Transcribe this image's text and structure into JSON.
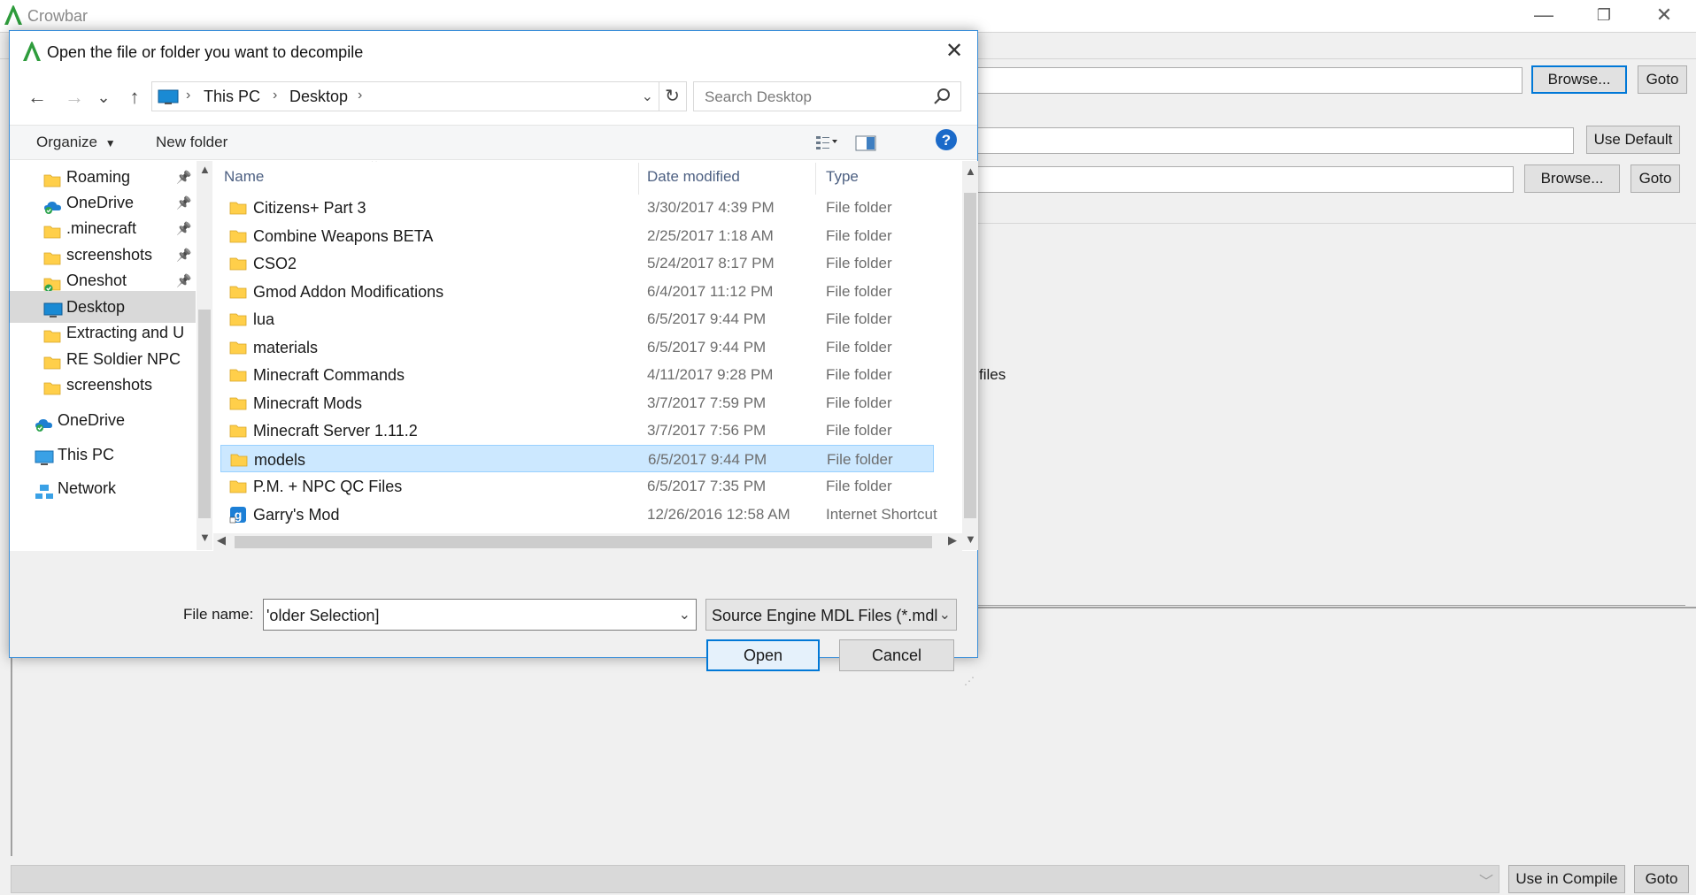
{
  "app": {
    "title": "Crowbar",
    "window_controls": {
      "minimize": "—",
      "restore": "❐",
      "close": "✕"
    },
    "browse_label": "Browse...",
    "goto_label": "Goto",
    "use_default_label": "Use Default",
    "files_label": "files",
    "use_in_compile_label": "Use in Compile",
    "dropdown_glyph": "﹀"
  },
  "dialog": {
    "title": "Open the file or folder you want to decompile",
    "close_glyph": "✕",
    "nav": {
      "back": "←",
      "forward": "→",
      "recent": "⌄",
      "up": "↑"
    },
    "breadcrumbs": [
      "This PC",
      "Desktop"
    ],
    "breadcrumb_sep": "›",
    "address_dropdown": "⌄",
    "refresh": "↻",
    "search_placeholder": "Search Desktop",
    "organize_label": "Organize",
    "new_folder_label": "New folder",
    "sidebar": [
      {
        "label": "Roaming",
        "icon": "folder-icon",
        "pinned": true,
        "selected": false,
        "indent": 1
      },
      {
        "label": "OneDrive",
        "icon": "onedrive-icon",
        "pinned": true,
        "selected": false,
        "indent": 1
      },
      {
        "label": ".minecraft",
        "icon": "folder-icon",
        "pinned": true,
        "selected": false,
        "indent": 1
      },
      {
        "label": "screenshots",
        "icon": "folder-icon",
        "pinned": true,
        "selected": false,
        "indent": 1
      },
      {
        "label": "Oneshot",
        "icon": "folder-synced-icon",
        "pinned": true,
        "selected": false,
        "indent": 1
      },
      {
        "label": "Desktop",
        "icon": "desktop-icon",
        "pinned": false,
        "selected": true,
        "indent": 1
      },
      {
        "label": "Extracting and U",
        "icon": "folder-icon",
        "pinned": false,
        "selected": false,
        "indent": 1
      },
      {
        "label": "RE Soldier NPC",
        "icon": "folder-icon",
        "pinned": false,
        "selected": false,
        "indent": 1
      },
      {
        "label": "screenshots",
        "icon": "folder-icon",
        "pinned": false,
        "selected": false,
        "indent": 1
      },
      {
        "label": "OneDrive",
        "icon": "onedrive-icon",
        "pinned": false,
        "selected": false,
        "indent": 0
      },
      {
        "label": "This PC",
        "icon": "this-pc-icon",
        "pinned": false,
        "selected": false,
        "indent": 0
      },
      {
        "label": "Network",
        "icon": "network-icon",
        "pinned": false,
        "selected": false,
        "indent": 0
      }
    ],
    "columns": {
      "name": "Name",
      "date": "Date modified",
      "type": "Type"
    },
    "files": [
      {
        "name": "Citizens+ Part 3",
        "date": "3/30/2017 4:39 PM",
        "type": "File folder",
        "icon": "folder-icon",
        "selected": false
      },
      {
        "name": "Combine Weapons BETA",
        "date": "2/25/2017 1:18 AM",
        "type": "File folder",
        "icon": "folder-icon",
        "selected": false
      },
      {
        "name": "CSO2",
        "date": "5/24/2017 8:17 PM",
        "type": "File folder",
        "icon": "folder-icon",
        "selected": false
      },
      {
        "name": "Gmod Addon Modifications",
        "date": "6/4/2017 11:12 PM",
        "type": "File folder",
        "icon": "folder-icon",
        "selected": false
      },
      {
        "name": "lua",
        "date": "6/5/2017 9:44 PM",
        "type": "File folder",
        "icon": "folder-icon",
        "selected": false
      },
      {
        "name": "materials",
        "date": "6/5/2017 9:44 PM",
        "type": "File folder",
        "icon": "folder-icon",
        "selected": false
      },
      {
        "name": "Minecraft Commands",
        "date": "4/11/2017 9:28 PM",
        "type": "File folder",
        "icon": "folder-icon",
        "selected": false
      },
      {
        "name": "Minecraft Mods",
        "date": "3/7/2017 7:59 PM",
        "type": "File folder",
        "icon": "folder-icon",
        "selected": false
      },
      {
        "name": "Minecraft Server 1.11.2",
        "date": "3/7/2017 7:56 PM",
        "type": "File folder",
        "icon": "folder-icon",
        "selected": false
      },
      {
        "name": "models",
        "date": "6/5/2017 9:44 PM",
        "type": "File folder",
        "icon": "folder-icon",
        "selected": true
      },
      {
        "name": "P.M. + NPC QC Files",
        "date": "6/5/2017 7:35 PM",
        "type": "File folder",
        "icon": "folder-icon",
        "selected": false
      },
      {
        "name": "Garry's Mod",
        "date": "12/26/2016 12:58 AM",
        "type": "Internet Shortcut",
        "icon": "garrys-mod-shortcut-icon",
        "selected": false
      }
    ],
    "file_name_label": "File name:",
    "file_name_value": "'older Selection]",
    "file_type_value": "Source Engine MDL Files (*.mdl",
    "open_label": "Open",
    "cancel_label": "Cancel",
    "colors": {
      "accent": "#0078d7",
      "selection": "#cce8ff",
      "folder": "#ffcf4a"
    }
  }
}
